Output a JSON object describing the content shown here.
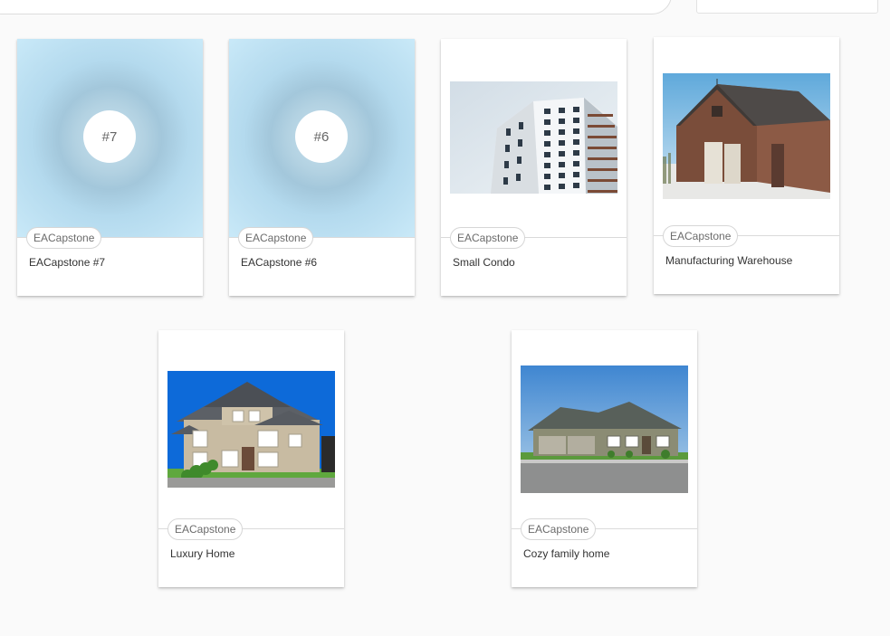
{
  "cards": [
    {
      "badge": "#7",
      "tag": "EACapstone",
      "title": "EACapstone #7"
    },
    {
      "badge": "#6",
      "tag": "EACapstone",
      "title": "EACapstone #6"
    },
    {
      "tag": "EACapstone",
      "title": "Small Condo",
      "image": "condo-building"
    },
    {
      "tag": "EACapstone",
      "title": "Manufacturing Warehouse",
      "image": "brick-barn"
    },
    {
      "tag": "EACapstone",
      "title": "Luxury Home",
      "image": "two-story-house"
    },
    {
      "tag": "EACapstone",
      "title": "Cozy family home",
      "image": "ranch-house"
    }
  ],
  "colors": {
    "background": "#fafafa",
    "card": "#ffffff",
    "chip_border": "#d6d6d6"
  }
}
